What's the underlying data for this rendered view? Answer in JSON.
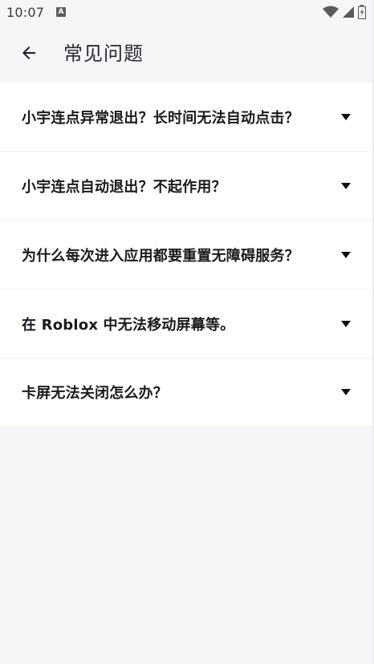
{
  "status_bar": {
    "time": "10:07",
    "notification_icon": "a-icon",
    "icons": [
      "wifi-icon",
      "signal-icon",
      "battery-icon"
    ]
  },
  "app_bar": {
    "back_icon": "arrow-left-icon",
    "title": "常见问题"
  },
  "faq": {
    "items": [
      {
        "question": "小宇连点异常退出？长时间无法自动点击？",
        "icon": "caret-down-icon"
      },
      {
        "question": "小宇连点自动退出？不起作用？",
        "icon": "caret-down-icon"
      },
      {
        "question": "为什么每次进入应用都要重置无障碍服务？",
        "icon": "caret-down-icon"
      },
      {
        "question": "在 Roblox 中无法移动屏幕等。",
        "icon": "caret-down-icon"
      },
      {
        "question": "卡屏无法关闭怎么办？",
        "icon": "caret-down-icon"
      }
    ]
  },
  "colors": {
    "background": "#f6f6f9",
    "card": "#ffffff",
    "text": "#1b1b1f",
    "divider": "#efeff3"
  }
}
